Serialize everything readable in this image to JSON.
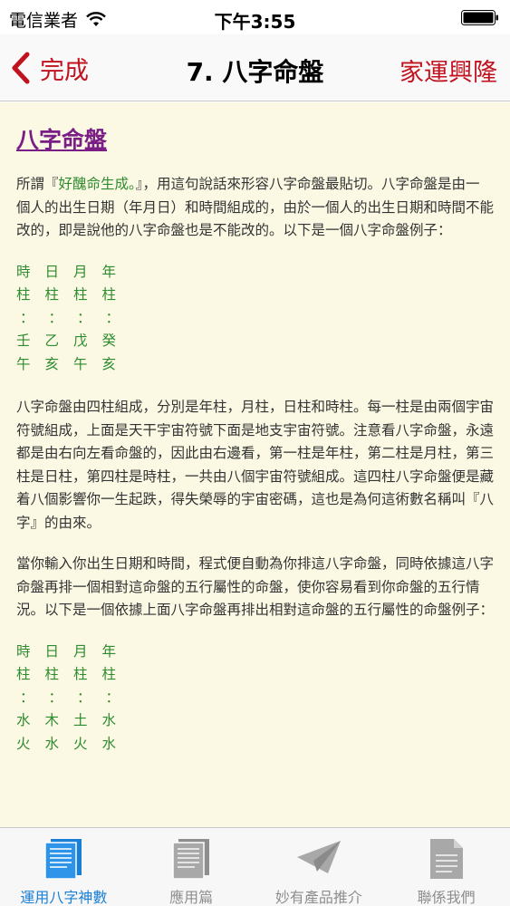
{
  "status_bar": {
    "carrier": "電信業者",
    "time": "下午3:55"
  },
  "nav": {
    "back_label": "完成",
    "title": "7. 八字命盤",
    "right_label": "家運興隆"
  },
  "content": {
    "heading": "八字命盤",
    "intro_prefix": "所謂『",
    "intro_highlight": "好醜命生成。",
    "intro_suffix": "』，用這句說話來形容八字命盤最貼切。八字命盤是由一個人的出生日期（年月日）和時間組成的，由於一個人的出生日期和時間不能改的，即是說他的八字命盤也是不能改的。以下是一個八字命盤例子：",
    "example1": [
      [
        "時",
        "日",
        "月",
        "年"
      ],
      [
        "柱",
        "柱",
        "柱",
        "柱"
      ],
      [
        "：",
        "：",
        "：",
        "："
      ],
      [
        "壬",
        "乙",
        "戊",
        "癸"
      ],
      [
        "午",
        "亥",
        "午",
        "亥"
      ]
    ],
    "para2": "八字命盤由四柱組成，分別是年柱，月柱，日柱和時柱。每一柱是由兩個宇宙符號組成，上面是天干宇宙符號下面是地支宇宙符號。注意看八字命盤，永遠都是由右向左看命盤的，因此由右邊看，第一柱是年柱，第二柱是月柱，第三柱是日柱，第四柱是時柱，一共由八個宇宙符號組成。這四柱八字命盤便是藏着八個影響你一生起跌，得失榮辱的宇宙密碼，這也是為何這術數名稱叫『八字』的由來。",
    "para3": "當你輸入你出生日期和時間，程式便自動為你排這八字命盤，同時依據這八字命盤再排一個相對這命盤的五行屬性的命盤，使你容易看到你命盤的五行情況。以下是一個依據上面八字命盤再排出相對這命盤的五行屬性的命盤例子：",
    "example2": [
      [
        "時",
        "日",
        "月",
        "年"
      ],
      [
        "柱",
        "柱",
        "柱",
        "柱"
      ],
      [
        "：",
        "：",
        "：",
        "："
      ],
      [
        "水",
        "木",
        "土",
        "水"
      ],
      [
        "火",
        "水",
        "火",
        "水"
      ]
    ]
  },
  "tabs": [
    {
      "label": "運用八字神數",
      "icon": "document-blue-icon",
      "active": true
    },
    {
      "label": "應用篇",
      "icon": "document-gray-icon",
      "active": false
    },
    {
      "label": "妙有產品推介",
      "icon": "paper-plane-icon",
      "active": false
    },
    {
      "label": "聯係我們",
      "icon": "page-icon",
      "active": false
    }
  ],
  "colors": {
    "accent_red": "#c1121f",
    "heading_purple": "#7a1e86",
    "pillar_green": "#2e8b2e",
    "content_bg": "#fbf9e4",
    "tab_active": "#1a7fd6"
  }
}
